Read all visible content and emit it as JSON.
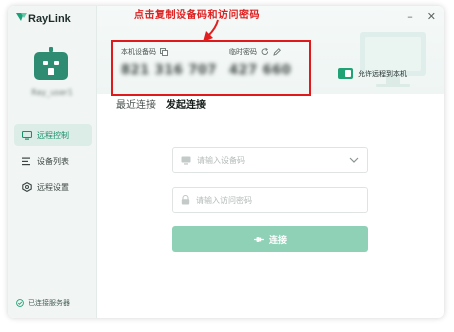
{
  "app": {
    "logo_text": "RayLink"
  },
  "window_controls": {
    "minimize": "–",
    "close": "✕"
  },
  "annotation": "点击复制设备码和访问密码",
  "user": {
    "name": "Ray_user1"
  },
  "sidebar": {
    "items": [
      {
        "label": "远程控制",
        "icon": "monitor-icon",
        "active": true
      },
      {
        "label": "设备列表",
        "icon": "list-icon",
        "active": false
      },
      {
        "label": "远程设置",
        "icon": "settings-icon",
        "active": false
      }
    ],
    "status": "已连接服务器"
  },
  "credentials": {
    "device_code_label": "本机设备码",
    "device_code": "821 316 707",
    "password_label": "临时密码",
    "password": "427 660"
  },
  "allow_remote": {
    "label": "允许远程到本机",
    "enabled": true
  },
  "tabs": [
    {
      "label": "最近连接",
      "active": false
    },
    {
      "label": "发起连接",
      "active": true
    }
  ],
  "form": {
    "device_placeholder": "请输入设备码",
    "password_placeholder": "请输入访问密码",
    "connect_label": "连接"
  },
  "colors": {
    "accent": "#1ea276",
    "annotation": "#e02020",
    "button": "#8fd1b6"
  }
}
